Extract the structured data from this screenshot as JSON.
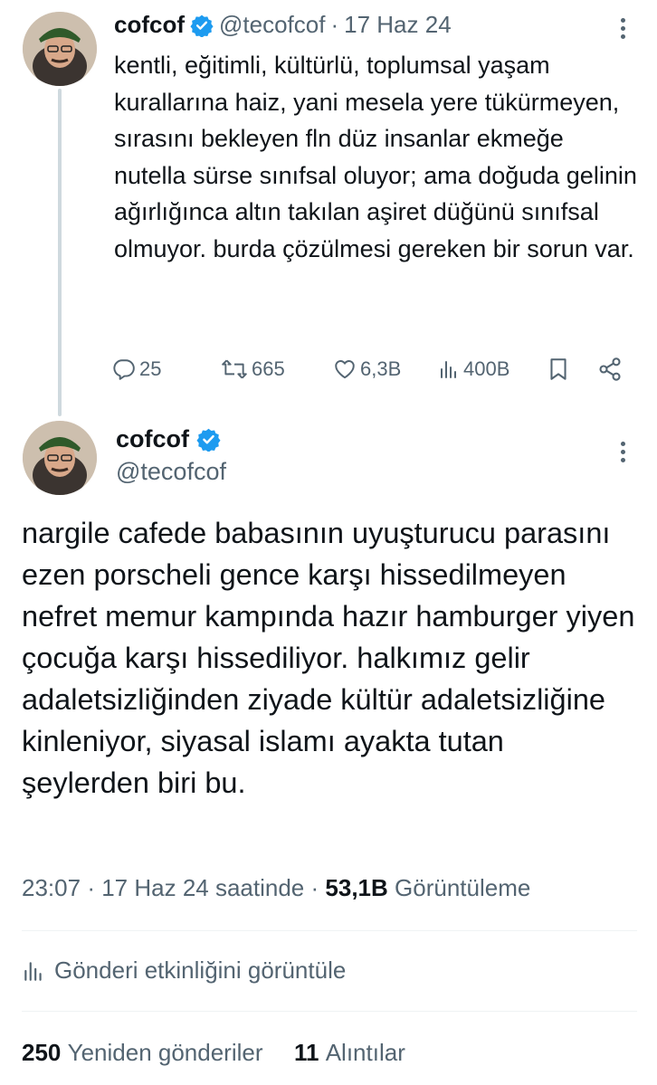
{
  "reply_tweet": {
    "display_name": "cofcof",
    "handle": "@tecofcof",
    "separator": "·",
    "date": "17 Haz 24",
    "text": "kentli, eğitimli, kültürlü, toplumsal yaşam kurallarına haiz, yani mesela yere tükürmeyen, sırasını bekleyen fln düz insanlar ekmeğe nutella sürse sınıfsal oluyor; ama doğuda gelinin ağırlığınca altın takılan aşiret düğünü sınıfsal olmuyor. burda çözülmesi gereken bir sorun var.",
    "actions": {
      "replies": "25",
      "reposts": "665",
      "likes": "6,3B",
      "views": "400B"
    }
  },
  "main_tweet": {
    "display_name": "cofcof",
    "handle": "@tecofcof",
    "text": "nargile cafede babasının uyuşturucu parasını ezen porscheli gence karşı hissedilmeyen nefret memur kampında hazır hamburger yiyen çocuğa karşı hissediliyor. halkımız gelir adaletsizliğinden ziyade kültür adaletsizliğine kinleniyor, siyasal islamı ayakta tutan şeylerden biri bu.",
    "time": "23:07",
    "separator": "·",
    "date_text": "17 Haz 24 saatinde",
    "views_count": "53,1B",
    "views_label": "Görüntüleme",
    "activity_label": "Gönderi etkinliğini görüntüle",
    "reposts_count": "250",
    "reposts_label": "Yeniden gönderiler",
    "quotes_count": "11",
    "quotes_label": "Alıntılar"
  },
  "colors": {
    "text": "#0f1419",
    "muted": "#536471",
    "verified": "#1d9bf0",
    "divider": "#eff3f4",
    "thread_line": "#cfd9de"
  },
  "icons": [
    "verified-badge-icon",
    "more-icon",
    "reply-icon",
    "repost-icon",
    "like-icon",
    "views-icon",
    "bookmark-icon",
    "share-icon",
    "analytics-icon"
  ]
}
